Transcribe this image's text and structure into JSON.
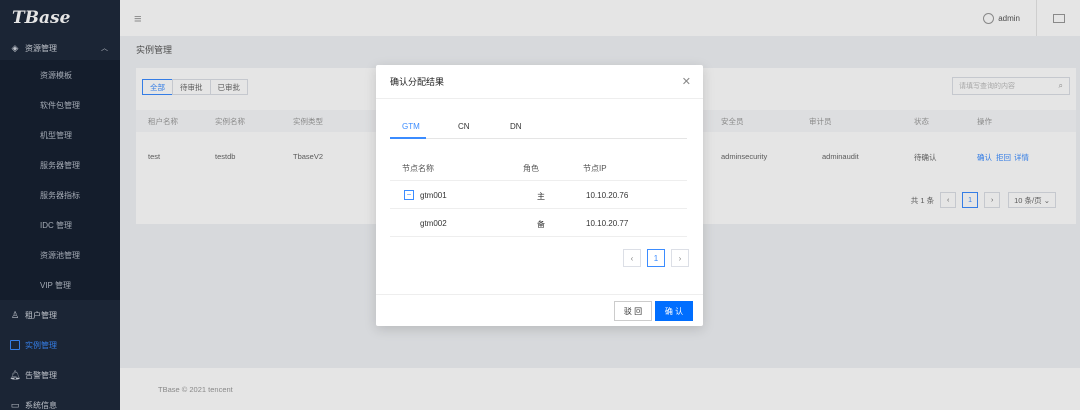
{
  "app": {
    "logo": "TBase"
  },
  "sidebar": {
    "group_resource": {
      "label": "资源管理",
      "icon": "layers-icon"
    },
    "sub_items": [
      "资源模板",
      "软件包管理",
      "机型管理",
      "服务器管理",
      "服务器指标",
      "IDC 管理",
      "资源池管理",
      "VIP 管理"
    ],
    "tenant": {
      "label": "租户管理",
      "icon": "users-icon"
    },
    "instance": {
      "label": "实例管理",
      "icon": "square-icon"
    },
    "alarm": {
      "label": "告警管理",
      "icon": "bell-icon"
    },
    "system": {
      "label": "系统信息",
      "icon": "monitor-icon"
    }
  },
  "header": {
    "user": "admin"
  },
  "page": {
    "title": "实例管理",
    "filter_tabs": [
      "全部",
      "待审批",
      "已审批"
    ],
    "search_placeholder": "请填写查询的内容",
    "table": {
      "headers": [
        "租户名称",
        "实例名称",
        "实例类型",
        "安全员",
        "审计员",
        "状态",
        "操作"
      ],
      "row": {
        "tenant": "test",
        "instance": "testdb",
        "type": "TbaseV2",
        "security": "adminsecurity",
        "auditor": "adminaudit",
        "status": "待确认",
        "actions": [
          "确认",
          "拒回",
          "详情"
        ]
      }
    },
    "pagination": {
      "total": "共 1 条",
      "current": "1",
      "size": "10 条/页"
    },
    "footer": "TBase © 2021 tencent"
  },
  "modal": {
    "title": "确认分配结果",
    "tabs": [
      "GTM",
      "CN",
      "DN"
    ],
    "active_tab": "GTM",
    "columns": [
      "节点名称",
      "角色",
      "节点IP"
    ],
    "rows": [
      {
        "name": "gtm001",
        "role": "主",
        "ip": "10.10.20.76"
      },
      {
        "name": "gtm002",
        "role": "备",
        "ip": "10.10.20.77"
      }
    ],
    "pager": {
      "current": "1"
    },
    "buttons": {
      "back": "驳 回",
      "confirm": "确 认"
    }
  }
}
